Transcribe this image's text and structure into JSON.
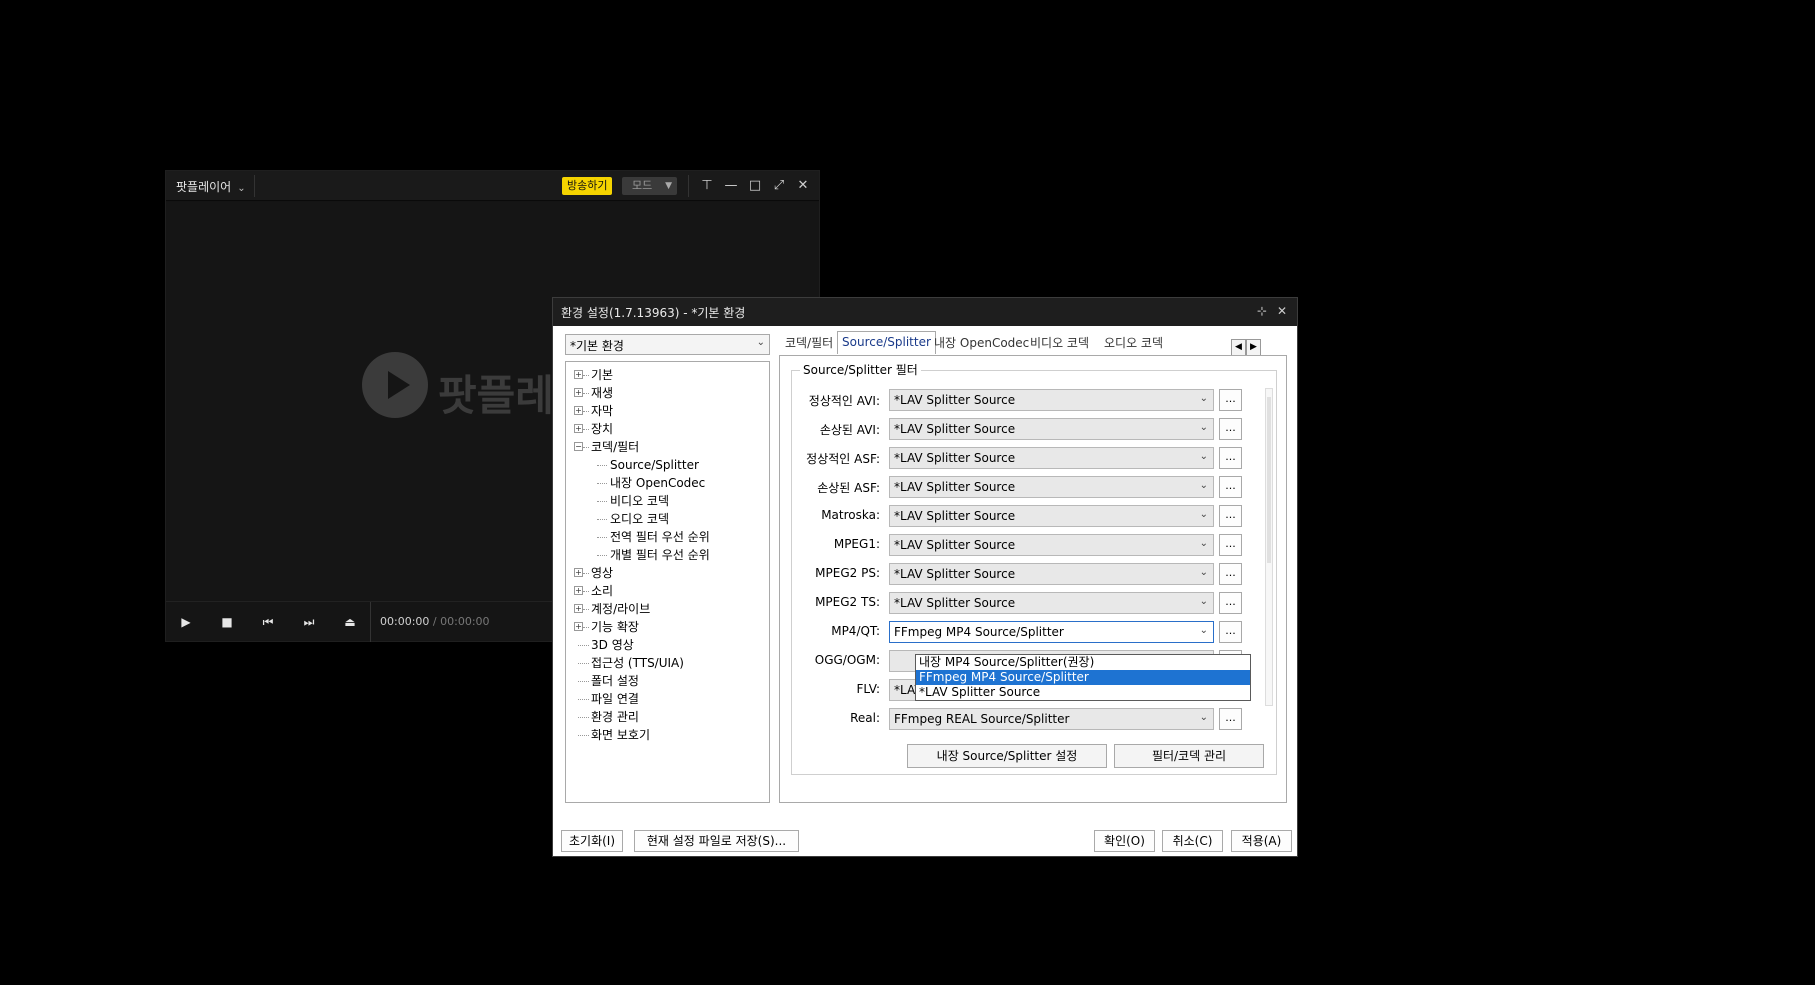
{
  "player": {
    "app_name": "팟플레이어",
    "broadcast_label": "방송하기",
    "mode_label": "모드",
    "logo_text": "팟플레",
    "time_current": "00:00:00",
    "time_separator": "/",
    "time_total": "00:00:00"
  },
  "dialog": {
    "title": "환경 설정(1.7.13963) - *기본 환경",
    "preset": "*기본 환경",
    "tree": {
      "top": [
        "기본",
        "재생",
        "자막",
        "장치",
        "코덱/필터"
      ],
      "codec_children": [
        "Source/Splitter",
        "내장 OpenCodec",
        "비디오 코덱",
        "오디오 코덱",
        "전역 필터 우선 순위",
        "개별 필터 우선 순위"
      ],
      "more": [
        "영상",
        "소리",
        "계정/라이브",
        "기능 확장",
        "3D 영상",
        "접근성 (TTS/UIA)",
        "폴더 설정",
        "파일 연결",
        "환경 관리",
        "화면 보호기"
      ]
    },
    "tabs": [
      "코덱/필터",
      "Source/Splitter",
      "내장 OpenCodec",
      "비디오 코덱",
      "오디오 코덱"
    ],
    "group_title": "Source/Splitter 필터",
    "rows": [
      {
        "label": "정상적인 AVI:",
        "value": "*LAV Splitter Source"
      },
      {
        "label": "손상된 AVI:",
        "value": "*LAV Splitter Source"
      },
      {
        "label": "정상적인 ASF:",
        "value": "*LAV Splitter Source"
      },
      {
        "label": "손상된 ASF:",
        "value": "*LAV Splitter Source"
      },
      {
        "label": "Matroska:",
        "value": "*LAV Splitter Source"
      },
      {
        "label": "MPEG1:",
        "value": "*LAV Splitter Source"
      },
      {
        "label": "MPEG2 PS:",
        "value": "*LAV Splitter Source"
      },
      {
        "label": "MPEG2 TS:",
        "value": "*LAV Splitter Source"
      },
      {
        "label": "MP4/QT:",
        "value": "FFmpeg MP4 Source/Splitter"
      },
      {
        "label": "OGG/OGM:",
        "value": ""
      },
      {
        "label": "FLV:",
        "value": "*LAV Splitter Source"
      },
      {
        "label": "Real:",
        "value": "FFmpeg REAL Source/Splitter"
      }
    ],
    "ellipsis": "...",
    "dropdown_options": [
      "내장 MP4 Source/Splitter(권장)",
      "FFmpeg MP4 Source/Splitter",
      "*LAV Splitter Source"
    ],
    "builtin_settings_button": "내장 Source/Splitter 설정",
    "filter_manage_button": "필터/코덱 관리",
    "reset_button": "초기화(I)",
    "save_button": "현재 설정 파일로 저장(S)...",
    "ok_button": "확인(O)",
    "cancel_button": "취소(C)",
    "apply_button": "적용(A)"
  }
}
